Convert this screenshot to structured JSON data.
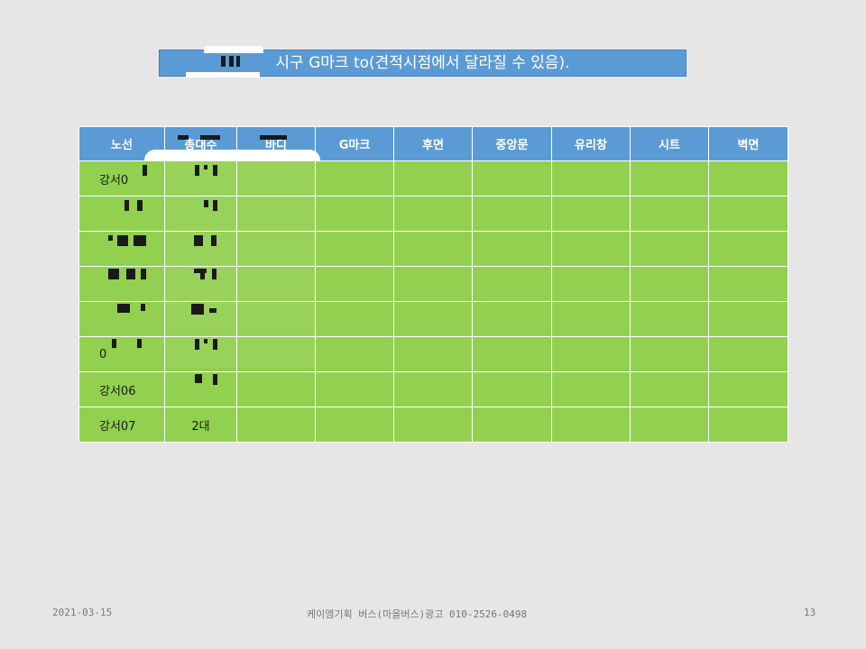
{
  "title": "시구 G마크 to(견적시점에서 달라질 수 있음).",
  "table": {
    "headers": [
      "노선",
      "총대수",
      "바디",
      "G마크",
      "후면",
      "중앙문",
      "유리창",
      "시트",
      "벽면"
    ],
    "rows": [
      {
        "route": "강서0",
        "count": ""
      },
      {
        "route": "",
        "count": ""
      },
      {
        "route": "",
        "count": ""
      },
      {
        "route": "",
        "count": ""
      },
      {
        "route": "",
        "count": ""
      },
      {
        "route": "0",
        "count": ""
      },
      {
        "route": "강서06",
        "count": ""
      },
      {
        "route": "강서07",
        "count": "2대"
      }
    ]
  },
  "footer": {
    "date": "2021-03-15",
    "company": "케이엠기획 버스(마을버스)광고 010-2526-0498",
    "page": "13"
  },
  "colors": {
    "header_blue": "#5b9bd5",
    "row_green": "#92d050",
    "background": "#e6e6e6"
  }
}
